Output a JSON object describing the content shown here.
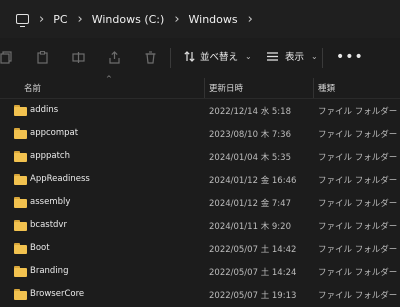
{
  "breadcrumb": {
    "items": [
      "PC",
      "Windows (C:)",
      "Windows"
    ]
  },
  "toolbar": {
    "sort_label": "並べ替え",
    "view_label": "表示",
    "more_label": "•••"
  },
  "columns": {
    "name": "名前",
    "date": "更新日時",
    "type": "種類"
  },
  "rows": [
    {
      "name": "addins",
      "date": "2022/12/14 水 5:18",
      "type": "ファイル フォルダー"
    },
    {
      "name": "appcompat",
      "date": "2023/08/10 木 7:36",
      "type": "ファイル フォルダー"
    },
    {
      "name": "apppatch",
      "date": "2024/01/04 木 5:35",
      "type": "ファイル フォルダー"
    },
    {
      "name": "AppReadiness",
      "date": "2024/01/12 金 16:46",
      "type": "ファイル フォルダー"
    },
    {
      "name": "assembly",
      "date": "2024/01/12 金 7:47",
      "type": "ファイル フォルダー"
    },
    {
      "name": "bcastdvr",
      "date": "2024/01/11 木 9:20",
      "type": "ファイル フォルダー"
    },
    {
      "name": "Boot",
      "date": "2022/05/07 土 14:42",
      "type": "ファイル フォルダー"
    },
    {
      "name": "Branding",
      "date": "2022/05/07 土 14:24",
      "type": "ファイル フォルダー"
    },
    {
      "name": "BrowserCore",
      "date": "2022/05/07 土 19:13",
      "type": "ファイル フォルダー"
    }
  ]
}
